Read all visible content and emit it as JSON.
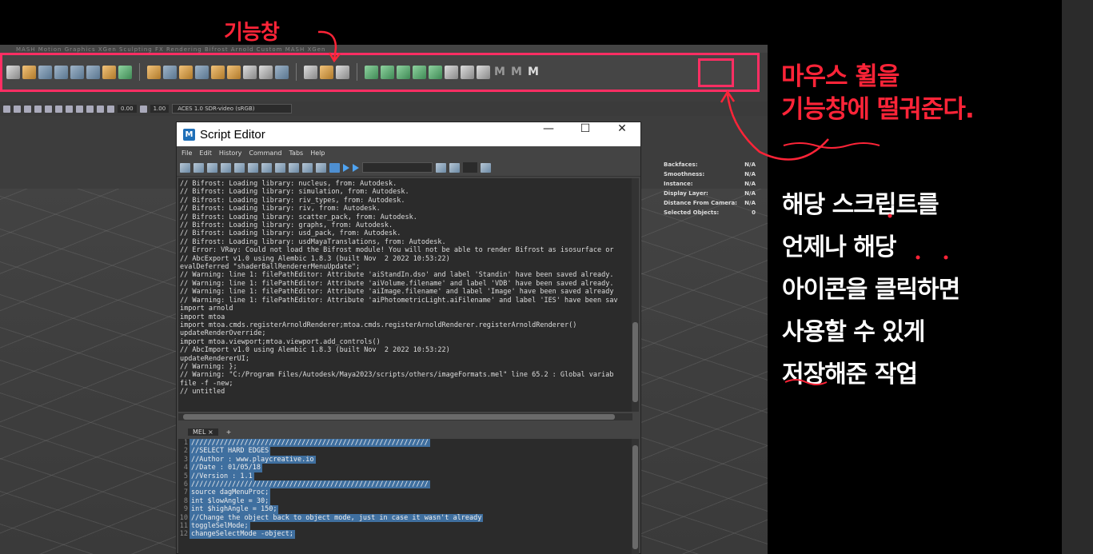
{
  "annotations": {
    "top_label": "기능창",
    "right_line1": "마우스 휠을",
    "right_line2": "기능창에 떨궈준다.",
    "white_lines": [
      "해당 스크립트를",
      "언제나 해당",
      "아이콘을 클릭하면",
      "사용할 수 있게",
      "저장해준 작업"
    ],
    "accent_color": "#ff2438"
  },
  "shelf": {
    "tabs_text": "MASH  Motion Graphics  XGen  Sculpting  FX  Rendering  Bifrost  Arnold  Custom  MASH  XGen",
    "m_icons": [
      "M",
      "M",
      "M"
    ]
  },
  "viewport_toolbar": {
    "value1": "0.00",
    "value2": "1.00",
    "colorspace": "ACES 1.0 SDR-video (sRGB)"
  },
  "hud": [
    {
      "label": "Backfaces:",
      "value": "N/A"
    },
    {
      "label": "Smoothness:",
      "value": "N/A"
    },
    {
      "label": "Instance:",
      "value": "N/A"
    },
    {
      "label": "Display Layer:",
      "value": "N/A"
    },
    {
      "label": "Distance From Camera:",
      "value": "N/A"
    },
    {
      "label": "Selected Objects:",
      "value": "0"
    }
  ],
  "script_editor": {
    "title": "Script Editor",
    "logo": "M",
    "window_buttons": [
      "—",
      "☐",
      "✕"
    ],
    "menu": [
      "File",
      "Edit",
      "History",
      "Command",
      "Tabs",
      "Help"
    ],
    "history_lines": [
      "// Bifrost: Loading library: nucleus, from: Autodesk.",
      "// Bifrost: Loading library: simulation, from: Autodesk.",
      "// Bifrost: Loading library: riv_types, from: Autodesk.",
      "// Bifrost: Loading library: riv, from: Autodesk.",
      "// Bifrost: Loading library: scatter_pack, from: Autodesk.",
      "// Bifrost: Loading library: graphs, from: Autodesk.",
      "// Bifrost: Loading library: usd_pack, from: Autodesk.",
      "// Bifrost: Loading library: usdMayaTranslations, from: Autodesk.",
      "// Error: VRay: Could not load the Bifrost module! You will not be able to render Bifrost as isosurface or",
      "// AbcExport v1.0 using Alembic 1.8.3 (built Nov  2 2022 10:53:22)",
      "evalDeferred \"shaderBallRendererMenuUpdate\";",
      "// Warning: line 1: filePathEditor: Attribute 'aiStandIn.dso' and label 'Standin' have been saved already.",
      "// Warning: line 1: filePathEditor: Attribute 'aiVolume.filename' and label 'VDB' have been saved already.",
      "// Warning: line 1: filePathEditor: Attribute 'aiImage.filename' and label 'Image' have been saved already",
      "// Warning: line 1: filePathEditor: Attribute 'aiPhotometricLight.aiFilename' and label 'IES' have been sav",
      "import arnold",
      "import mtoa",
      "import mtoa.cmds.registerArnoldRenderer;mtoa.cmds.registerArnoldRenderer.registerArnoldRenderer()",
      "updateRenderOverride;",
      "import mtoa.viewport;mtoa.viewport.add_controls()",
      "// AbcImport v1.0 using Alembic 1.8.3 (built Nov  2 2022 10:53:22)",
      "updateRendererUI;",
      "// Warning: };",
      "// Warning: \"C:/Program Files/Autodesk/Maya2023/scripts/others/imageFormats.mel\" line 65.2 : Global variab",
      "file -f -new;",
      "// untitled"
    ],
    "input_tab": "MEL",
    "input_tab_close": "×",
    "input_tab_add": "+",
    "input_lines": [
      "//////////////////////////////////////////////////////////",
      "//SELECT HARD EDGES",
      "//Author : www.playcreative.io",
      "//Date : 01/05/18",
      "//Version : 1.1",
      "//////////////////////////////////////////////////////////",
      "source dagMenuProc;",
      "int $lowAngle = 30;",
      "int $highAngle = 150;",
      "//Change the object back to object mode, just in case it wasn't already",
      "toggleSelMode;",
      "changeSelectMode -object;"
    ]
  }
}
